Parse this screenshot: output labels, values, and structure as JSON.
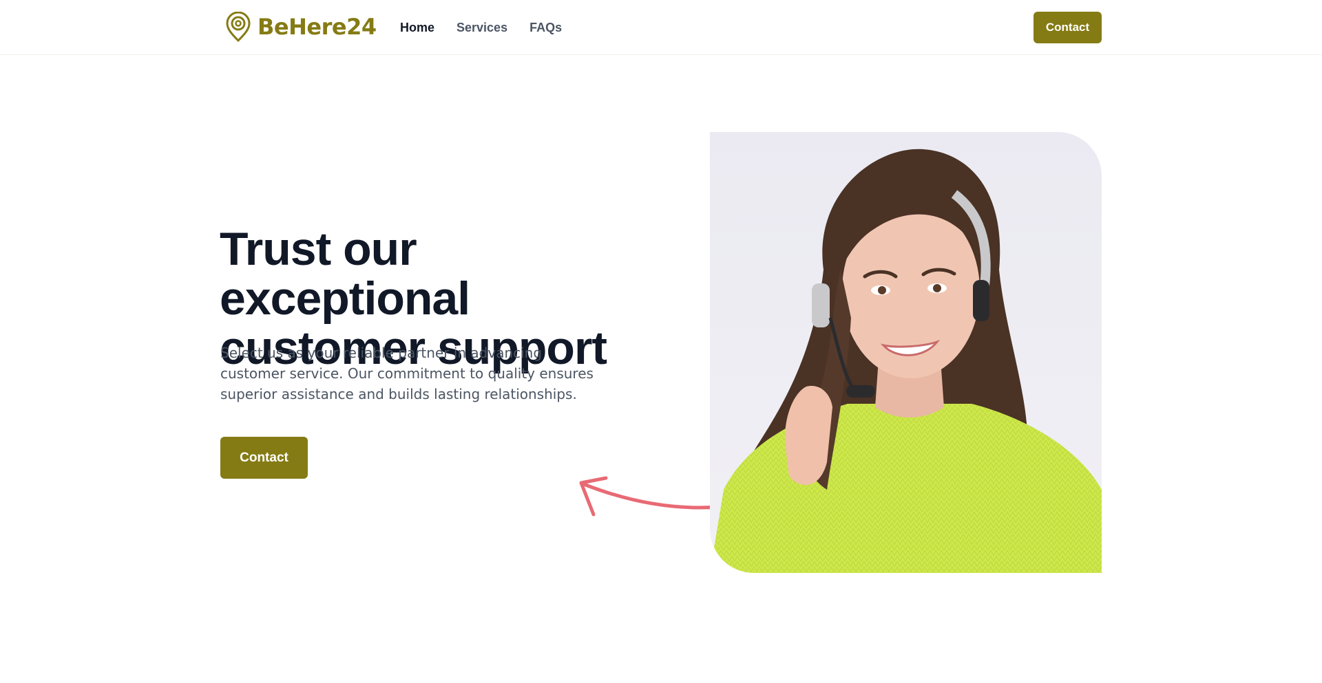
{
  "brand": {
    "name": "BeHere24",
    "icon": "map-pin-icon",
    "color": "#857b14"
  },
  "nav": {
    "items": [
      {
        "label": "Home",
        "active": true
      },
      {
        "label": "Services",
        "active": false
      },
      {
        "label": "FAQs",
        "active": false
      }
    ],
    "contact_label": "Contact"
  },
  "hero": {
    "title": "Trust our exceptional customer support",
    "description": "Select us as your reliable partner in advancing customer service. Our commitment to quality ensures superior assistance and builds lasting relationships.",
    "cta_label": "Contact",
    "arrow_icon": "curved-arrow-icon",
    "arrow_color": "#e86a74",
    "image": "support-agent-photo"
  },
  "colors": {
    "accent": "#857b14",
    "heading": "#111827",
    "body": "#4b5563"
  }
}
